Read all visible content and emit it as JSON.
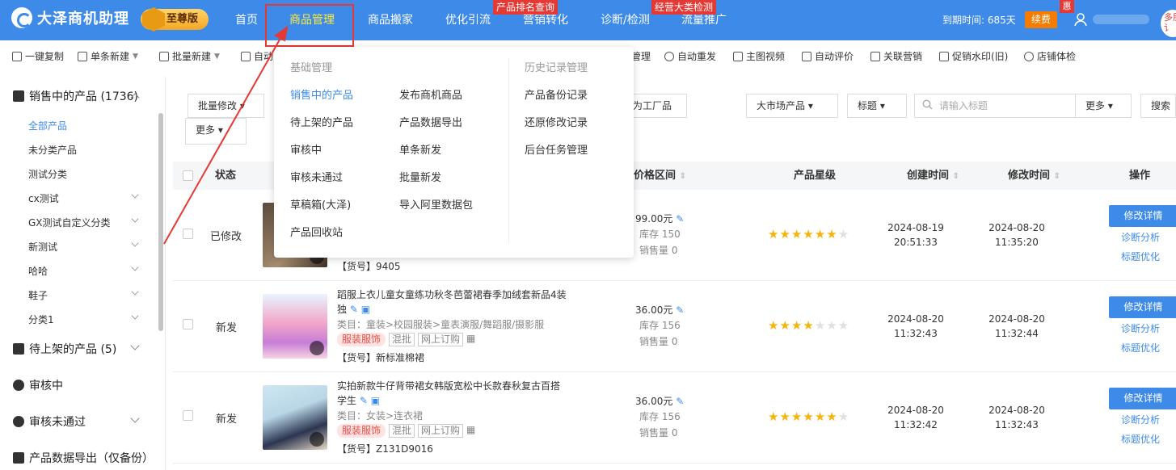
{
  "app": {
    "name": "大泽商机助理",
    "edition": "至尊版"
  },
  "nav": [
    {
      "label": "首页"
    },
    {
      "label": "商品管理",
      "active": true
    },
    {
      "label": "商品搬家"
    },
    {
      "label": "优化引流"
    },
    {
      "label": "营销转化",
      "badge": "产品排名查询"
    },
    {
      "label": "诊断/检测"
    },
    {
      "label": "流量推广",
      "badge": "经营大类检测"
    }
  ],
  "account": {
    "expire": "到期时间: 685天",
    "renew": "续费",
    "hui": "惠",
    "corner": "多朋讠"
  },
  "toolbar": [
    {
      "label": "一键复制",
      "icon": "copy-icon"
    },
    {
      "label": "单条新建",
      "icon": "plus-icon",
      "arrow": true
    },
    {
      "label": "批量新建",
      "icon": "plus-icon",
      "arrow": true
    },
    {
      "label": "自动",
      "icon": "list-icon"
    },
    {
      "label": "管理"
    },
    {
      "label": "自动重发",
      "icon": "refresh-icon"
    },
    {
      "label": "主图视频",
      "icon": "video-icon"
    },
    {
      "label": "自动评价",
      "icon": "comment-icon"
    },
    {
      "label": "关联营销",
      "icon": "link-icon"
    },
    {
      "label": "促销水印(旧)",
      "icon": "watermark-icon"
    },
    {
      "label": "店铺体检",
      "icon": "check-icon"
    }
  ],
  "sidebar": {
    "groups": [
      {
        "label": "销售中的产品 (1736)"
      },
      {
        "label": "待上架的产品 (5)"
      },
      {
        "label": "审核中"
      },
      {
        "label": "审核未通过"
      },
      {
        "label": "产品数据导出（仅备份）"
      }
    ],
    "items": [
      "全部产品",
      "未分类产品",
      "测试分类",
      "cx测试",
      "GX测试自定义分类",
      "新测试",
      "哈哈",
      "鞋子",
      "分类1"
    ]
  },
  "filters": {
    "batch_modify": "批量修改",
    "more_left": "更多",
    "factory": "为工厂品",
    "market": "大市场产品",
    "title_sel": "标题",
    "search_placeholder": "请输入标题",
    "more": "更多",
    "search": "搜索"
  },
  "table": {
    "headers": {
      "status": "状态",
      "price": "价格区间",
      "star": "产品星级",
      "created": "创建时间",
      "modified": "修改时间",
      "op": "操作"
    },
    "rows": [
      {
        "status": "已修改",
        "code": "【货号】9405",
        "price": "99.00元",
        "stock": "库存 150",
        "sales": "销售量 0",
        "stars": 6,
        "created_date": "2024-08-19",
        "created_time": "20:51:33",
        "modified_date": "2024-08-20",
        "modified_time": "11:35:20"
      },
      {
        "status": "新发",
        "title": "蹈服上衣儿童女童练功秋冬芭蕾裙春季加绒套新品4装独",
        "category": "类目：童装>校园服装>童表演服/舞蹈服/摄影服",
        "tags": [
          "服装服饰",
          "混批",
          "网上订购"
        ],
        "code": "【货号】新标准棉裙",
        "price": "36.00元",
        "stock": "库存 156",
        "sales": "销售量 0",
        "stars": 4,
        "created_date": "2024-08-20",
        "created_time": "11:32:43",
        "modified_date": "2024-08-20",
        "modified_time": "11:32:44"
      },
      {
        "status": "新发",
        "title": "实拍新款牛仔背带裙女韩版宽松中长款春秋复古百搭学生",
        "category": "类目：女装>连衣裙",
        "tags": [
          "服装服饰",
          "混批",
          "网上订购"
        ],
        "code": "【货号】Z131D9016",
        "price": "36.00元",
        "stock": "库存 156",
        "sales": "销售量 0",
        "stars": 6,
        "created_date": "2024-08-20",
        "created_time": "11:32:42",
        "modified_date": "2024-08-20",
        "modified_time": "11:32:43"
      }
    ],
    "ops": {
      "edit": "修改详情",
      "diagnose": "诊断分析",
      "title_opt": "标题优化"
    }
  },
  "dropdown": {
    "basic_title": "基础管理",
    "history_title": "历史记录管理",
    "col1": [
      "销售中的产品",
      "待上架的产品",
      "审核中",
      "审核未通过",
      "草稿箱(大泽)",
      "产品回收站"
    ],
    "col2": [
      "发布商机商品",
      "产品数据导出",
      "单条新发",
      "批量新发",
      "导入阿里数据包"
    ],
    "col3": [
      "产品备份记录",
      "还原修改记录",
      "后台任务管理"
    ]
  },
  "colors": {
    "primary": "#3d8ae8",
    "annotation": "#e53935",
    "star": "#f6b30a"
  }
}
